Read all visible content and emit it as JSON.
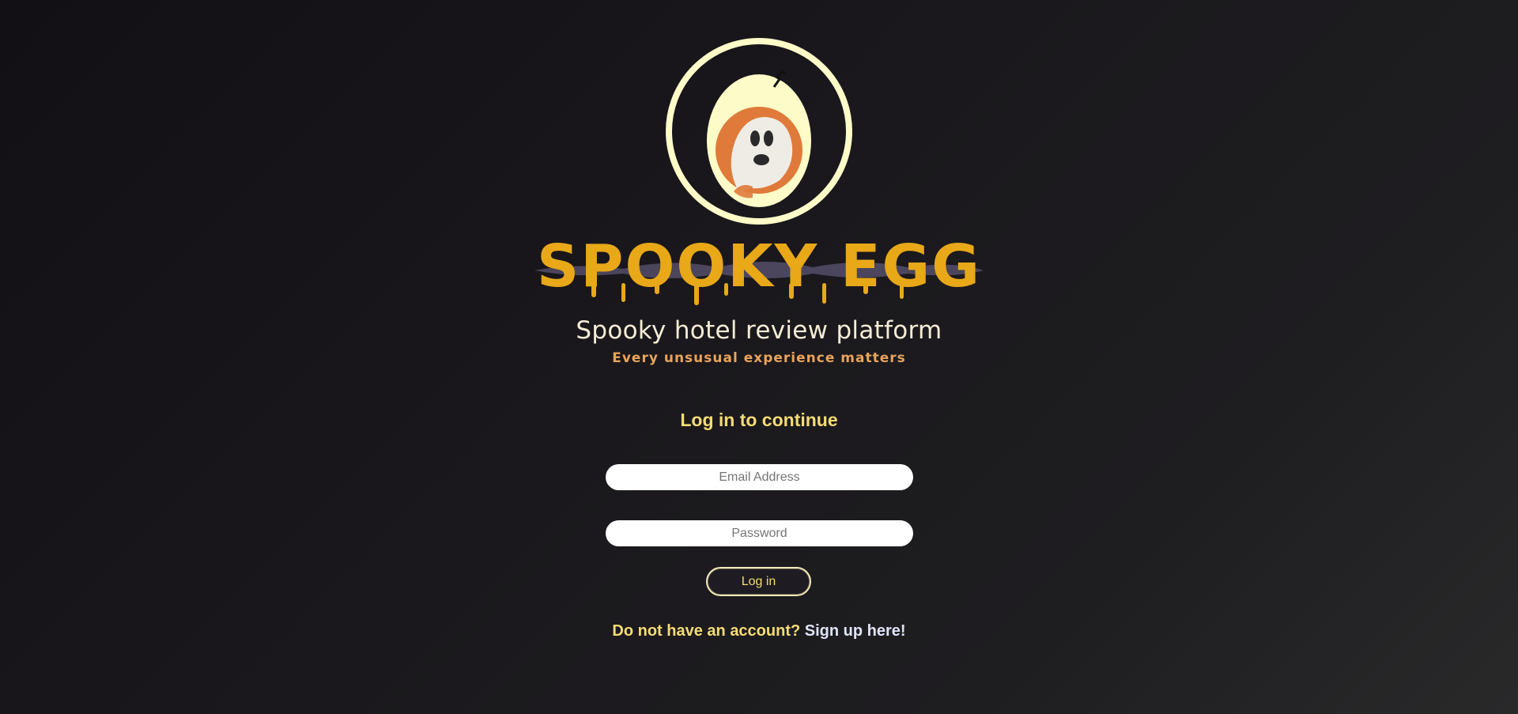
{
  "branding": {
    "logo_text": "SPOOKY EGG",
    "tagline": "Spooky hotel review platform",
    "motto": "Every unsusual experience matters"
  },
  "login": {
    "title": "Log in to continue",
    "email_placeholder": "Email Address",
    "password_placeholder": "Password",
    "submit_label": "Log in"
  },
  "signup": {
    "prompt": "Do not have an account?",
    "link_label": "Sign up here!"
  },
  "colors": {
    "accent_yellow": "#f4dc74",
    "logo_gold": "#e8a818",
    "egg_cream": "#fdfbc8",
    "ghost_orange": "#e07a3a",
    "background": "#1a181c"
  }
}
